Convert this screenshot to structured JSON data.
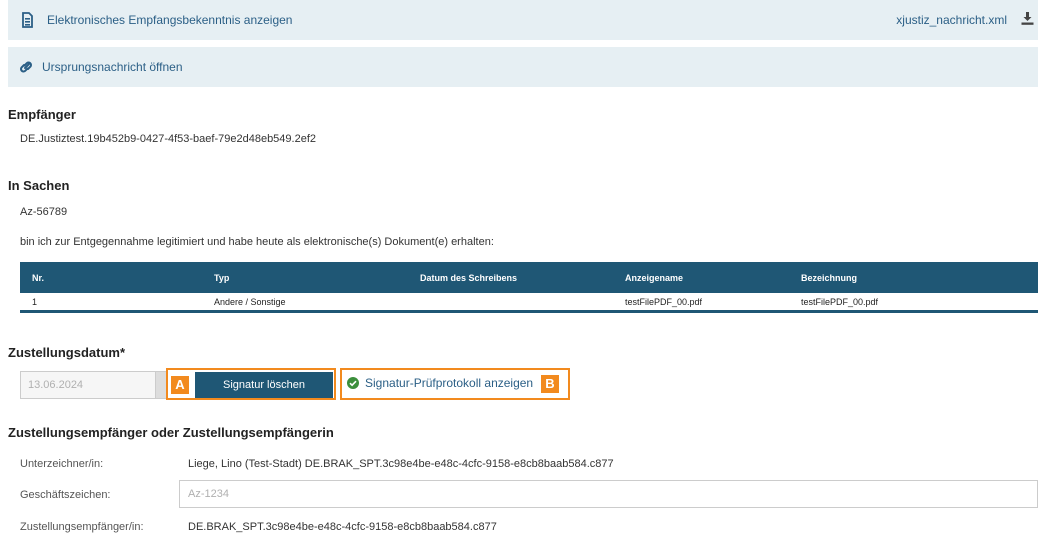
{
  "header_bar": {
    "receipt_link": "Elektronisches Empfangsbekenntnis anzeigen",
    "file_name": "xjustiz_nachricht.xml",
    "origin_link": "Ursprungsnachricht öffnen"
  },
  "empfaenger": {
    "heading": "Empfänger",
    "value": "DE.Justiztest.19b452b9-0427-4f53-baef-79e2d48eb549.2ef2"
  },
  "in_sachen": {
    "heading": "In Sachen",
    "az": "Az-56789",
    "statement": "bin ich zur Entgegennahme legitimiert und habe heute als elektronische(s) Dokument(e) erhalten:"
  },
  "table": {
    "columns": [
      "Nr.",
      "Typ",
      "Datum des Schreibens",
      "Anzeigename",
      "Bezeichnung"
    ],
    "rows": [
      [
        "1",
        "Andere / Sonstige",
        "",
        "testFilePDF_00.pdf",
        "testFilePDF_00.pdf"
      ]
    ]
  },
  "zustellung": {
    "heading": "Zustellungsdatum*",
    "date_placeholder": "13.06.2024",
    "tag_a": "A",
    "signature_button": "Signatur löschen",
    "protocol_link": "Signatur-Prüfprotokoll anzeigen",
    "tag_b": "B"
  },
  "empfaenger_section": {
    "heading": "Zustellungsempfänger oder Zustellungsempfängerin",
    "signer_label": "Unterzeichner/in:",
    "signer_value": "Liege, Lino (Test-Stadt) DE.BRAK_SPT.3c98e4be-e48c-4cfc-9158-e8cb8baab584.c877",
    "ref_label": "Geschäftszeichen:",
    "ref_placeholder": "Az-1234",
    "recipient_label": "Zustellungsempfänger/in:",
    "recipient_value": "DE.BRAK_SPT.3c98e4be-e48c-4cfc-9158-e8cb8baab584.c877"
  },
  "colors": {
    "accent": "#1f5775",
    "link": "#2b5f86",
    "highlight": "#f28a1e",
    "bar_bg": "#e6eff3",
    "success": "#3c8f3c"
  },
  "icons": {
    "receipt": "document-icon",
    "download": "download-icon",
    "origin": "link-icon",
    "protocol": "check-circle-icon"
  }
}
